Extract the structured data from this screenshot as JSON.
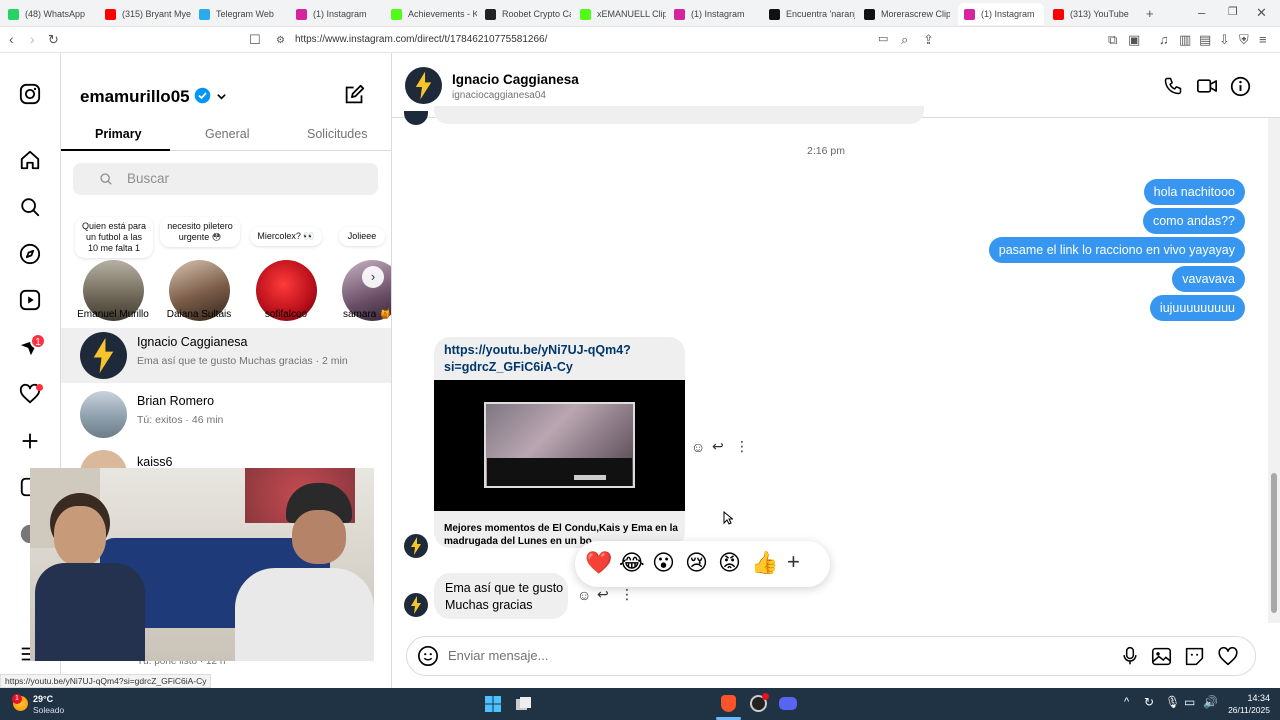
{
  "browser": {
    "tabs": [
      {
        "label": "(48) WhatsApp",
        "color": "#25d366"
      },
      {
        "label": "(315) Bryant Myers",
        "color": "#ff0000"
      },
      {
        "label": "Telegram Web",
        "color": "#2aabee"
      },
      {
        "label": "(1) Instagram",
        "color": "#d6249f"
      },
      {
        "label": "Achievements - Kick",
        "color": "#53fc18"
      },
      {
        "label": "Roobet Crypto Casino",
        "color": "#222222"
      },
      {
        "label": "xEMANUELL Clips",
        "color": "#53fc18"
      },
      {
        "label": "(1) Instagram",
        "color": "#d6249f"
      },
      {
        "label": "Encuentra 'naranja'",
        "color": "#111111"
      },
      {
        "label": "Morerascrew Clips",
        "color": "#111111"
      },
      {
        "label": "(1) Instagram",
        "color": "#d6249f"
      },
      {
        "label": "(313) YouTube",
        "color": "#ff0000"
      }
    ],
    "url": "https://www.instagram.com/direct/t/17846210775581266/",
    "status_url": "https://youtu.be/yNi7UJ-qQm4?si=gdrcZ_GFiC6iA-Cy"
  },
  "rail": {
    "notifications_badge": "1"
  },
  "sidebar": {
    "username": "emamurillo05",
    "tabs": [
      "Primary",
      "General",
      "Solicitudes"
    ],
    "search_placeholder": "Buscar",
    "notes": [
      {
        "text": "Quien está para un futbol a las 10 me falta 1",
        "name": "Emanuel Murillo"
      },
      {
        "text": "necesito piletero urgente 😳",
        "name": "Daiana Sultais"
      },
      {
        "text": "Miercolex? 👀",
        "name": "sofifalcoo"
      },
      {
        "text": "Jolieee",
        "name": "samara 🍯"
      }
    ],
    "conversations": [
      {
        "name": "Ignacio Caggianesa",
        "preview": "Ema así que te gusto Muchas gracias · 2 min"
      },
      {
        "name": "Brian Romero",
        "preview": "Tú: exitos · 46 min"
      },
      {
        "name": "kaiss6",
        "preview": ""
      },
      {
        "name": "",
        "preview": "Tú: pone listo · 12 h"
      }
    ]
  },
  "chat": {
    "name": "Ignacio Caggianesa",
    "handle": "ignaciocaggianesa04",
    "timestamp": "2:16 pm",
    "my_messages": [
      "hola nachitooo",
      "como andas??",
      "pasame el link lo racciono en vivo yayayay",
      "vavavava",
      "iujuuuuuuuuu"
    ],
    "link_url_line1": "https://youtu.be/yNi7UJ-qQm4?",
    "link_url_line2": "si=gdrcZ_GFiC6iA-Cy",
    "link_title_line1": "Mejores momentos de El Condu,Kais y Ema en la",
    "link_title_line2": "madrugada del Lunes en un bo",
    "last_message_line1": "Ema así que te gusto",
    "last_message_line2": "Muchas gracias",
    "reactions": [
      "❤️",
      "😂",
      "😮",
      "😢",
      "😡",
      "👍"
    ],
    "input_placeholder": "Enviar mensaje..."
  },
  "taskbar": {
    "temp": "29°C",
    "weather": "Soleado",
    "weather_badge": "1",
    "time": "14:34",
    "date": "26/11/2025"
  }
}
